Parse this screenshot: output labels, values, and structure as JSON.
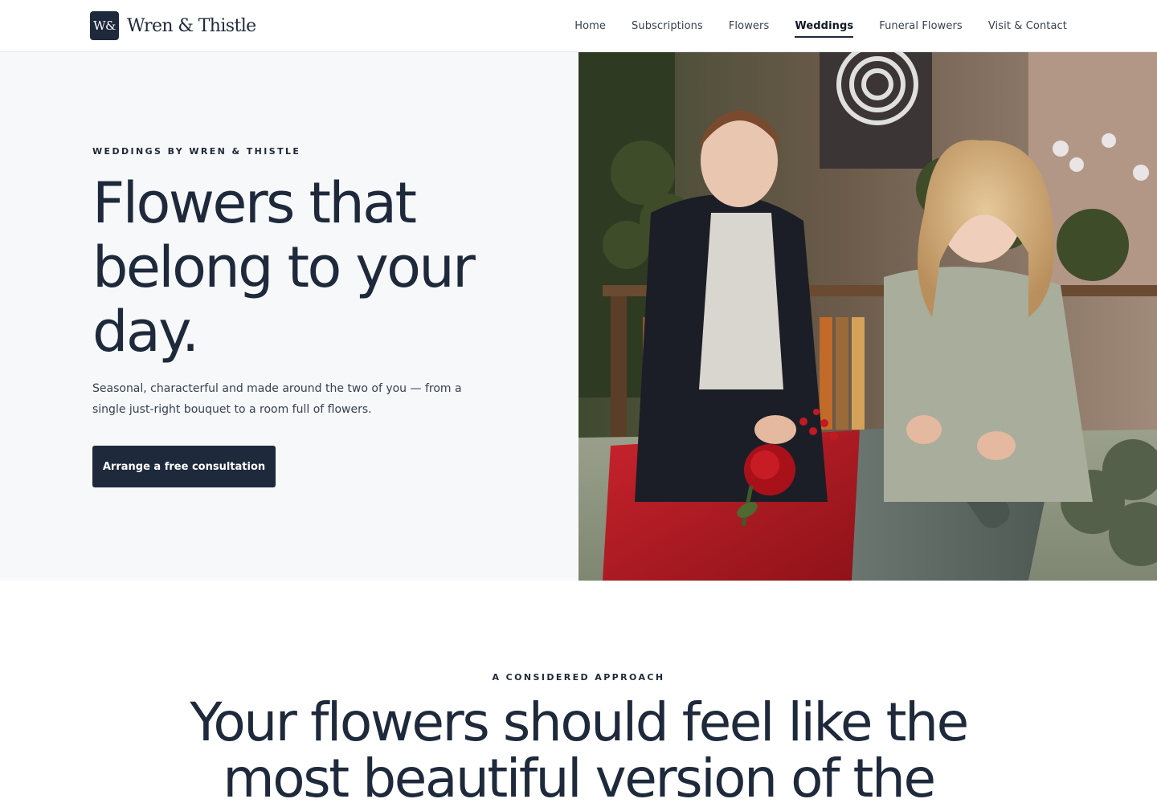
{
  "header": {
    "brand_mark": "W&",
    "brand_name": "Wren & Thistle",
    "nav": [
      {
        "label": "Home"
      },
      {
        "label": "Subscriptions"
      },
      {
        "label": "Flowers"
      },
      {
        "label": "Weddings",
        "active": true
      },
      {
        "label": "Funeral Flowers"
      },
      {
        "label": "Visit & Contact"
      }
    ]
  },
  "hero": {
    "eyebrow": "WEDDINGS BY WREN & THISTLE",
    "title": "Flowers that belong to your day.",
    "subtitle": "Seasonal, characterful and made around the two of you — from a single just-right bouquet to a room full of flowers.",
    "cta_label": "Arrange a free consultation"
  },
  "approach": {
    "eyebrow": "A CONSIDERED APPROACH",
    "title": "Your flowers should feel like the most beautiful version of the"
  },
  "colors": {
    "navy": "#1e293b",
    "hero_bg": "#f7f8fa",
    "text": "#374151",
    "border": "#e5e7eb"
  }
}
